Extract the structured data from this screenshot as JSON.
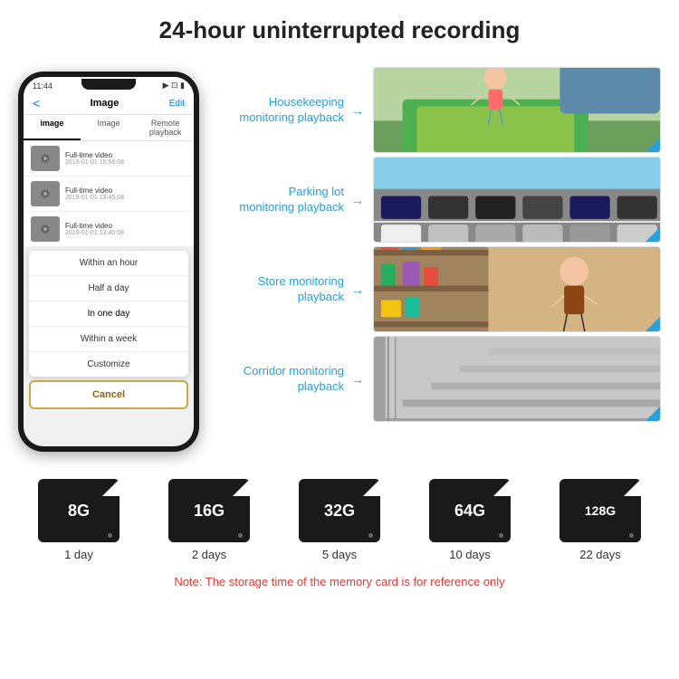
{
  "header": {
    "title": "24-hour uninterrupted recording"
  },
  "phone": {
    "status_time": "11:44",
    "nav_back": "<",
    "nav_title": "Image",
    "nav_edit": "Edit",
    "tabs": [
      "image",
      "Image",
      "Remote playback"
    ],
    "list_items": [
      {
        "label": "Full-time video",
        "date": "2019-01-01 15:56:08"
      },
      {
        "label": "Full-time video",
        "date": "2019-01-01 13:45:08"
      },
      {
        "label": "Full-time video",
        "date": "2019-01-01 13:40:08"
      }
    ],
    "dropdown_items": [
      "Within an hour",
      "Half a day",
      "In one day",
      "Within a week",
      "Customize"
    ],
    "cancel_label": "Cancel"
  },
  "monitoring": {
    "items": [
      {
        "label": "Housekeeping monitoring playback",
        "img_type": "housekeeping"
      },
      {
        "label": "Parking lot monitoring playback",
        "img_type": "parking"
      },
      {
        "label": "Store monitoring playback",
        "img_type": "store"
      },
      {
        "label": "Corridor monitoring playback",
        "img_type": "corridor"
      }
    ]
  },
  "storage": {
    "cards": [
      {
        "size": "8G",
        "days": "1 day"
      },
      {
        "size": "16G",
        "days": "2 days"
      },
      {
        "size": "32G",
        "days": "5 days"
      },
      {
        "size": "64G",
        "days": "10 days"
      },
      {
        "size": "128G",
        "days": "22 days"
      }
    ],
    "note": "Note: The storage time of the memory card is for reference only"
  },
  "colors": {
    "accent_blue": "#2a9fd8",
    "note_red": "#e53935",
    "card_bg": "#1a1a1a"
  }
}
